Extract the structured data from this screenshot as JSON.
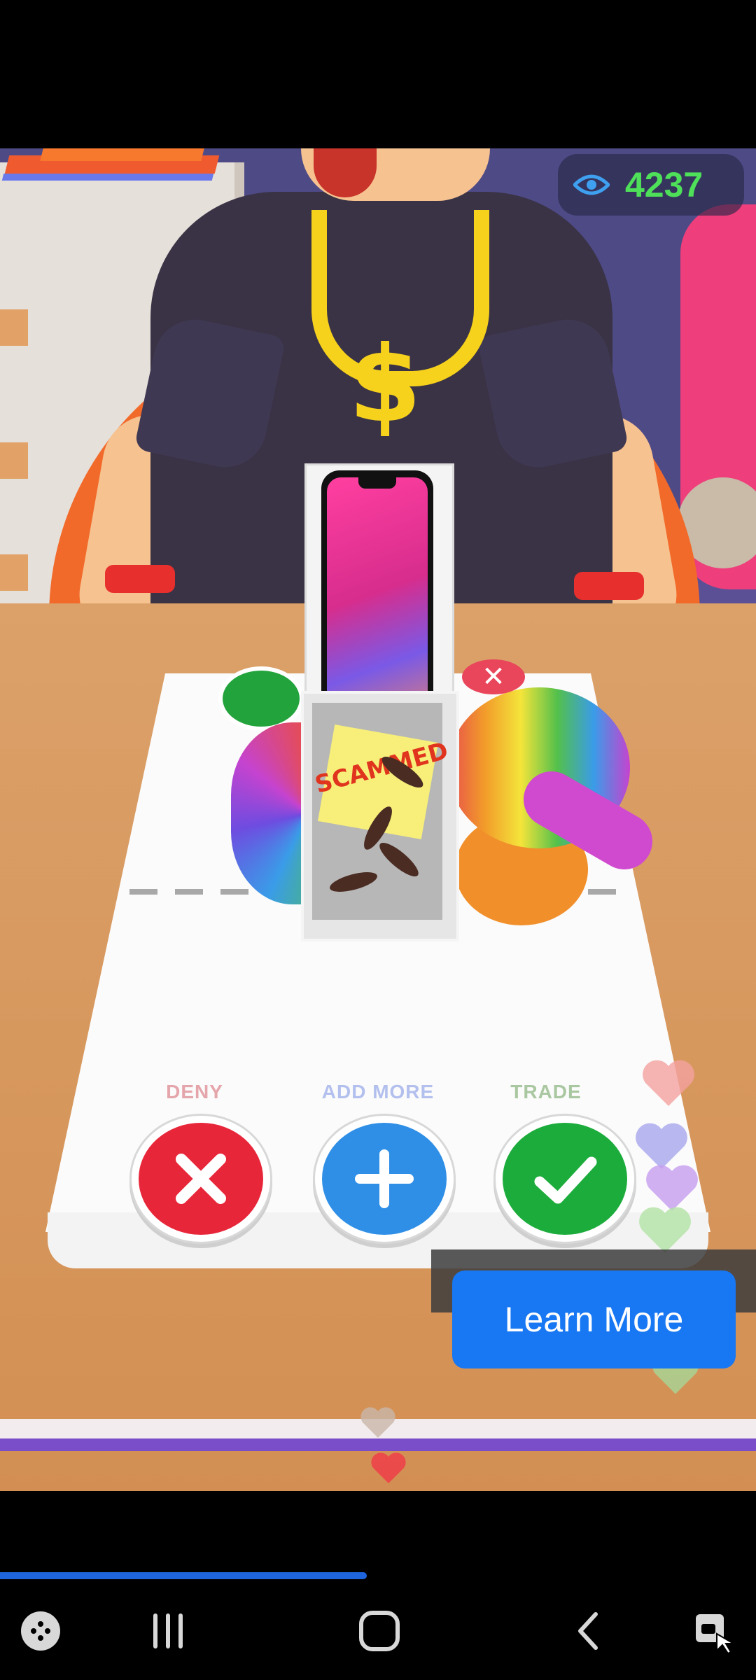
{
  "views": {
    "count": "4237",
    "icon": "eye-icon",
    "color": "#4fe05a"
  },
  "game": {
    "note_text": "SCAMMED",
    "actions": [
      {
        "label": "DENY",
        "icon": "x-icon",
        "color": "#e8263a",
        "label_color": "#e4a5ab"
      },
      {
        "label": "ADD MORE",
        "icon": "plus-icon",
        "color": "#2f8fe6",
        "label_color": "#b3c0ee"
      },
      {
        "label": "TRADE",
        "icon": "check-icon",
        "color": "#1cac3c",
        "label_color": "#a9c7a0"
      }
    ],
    "mat_knob_x": "✕"
  },
  "ad": {
    "cta_label": "Learn More",
    "cta_color": "#1877f2"
  },
  "video_progress": 0.485,
  "navbar": {
    "items": [
      {
        "name": "game-launcher-icon"
      },
      {
        "name": "recents-icon"
      },
      {
        "name": "home-icon"
      },
      {
        "name": "back-icon"
      },
      {
        "name": "screen-lock-icon"
      }
    ]
  }
}
